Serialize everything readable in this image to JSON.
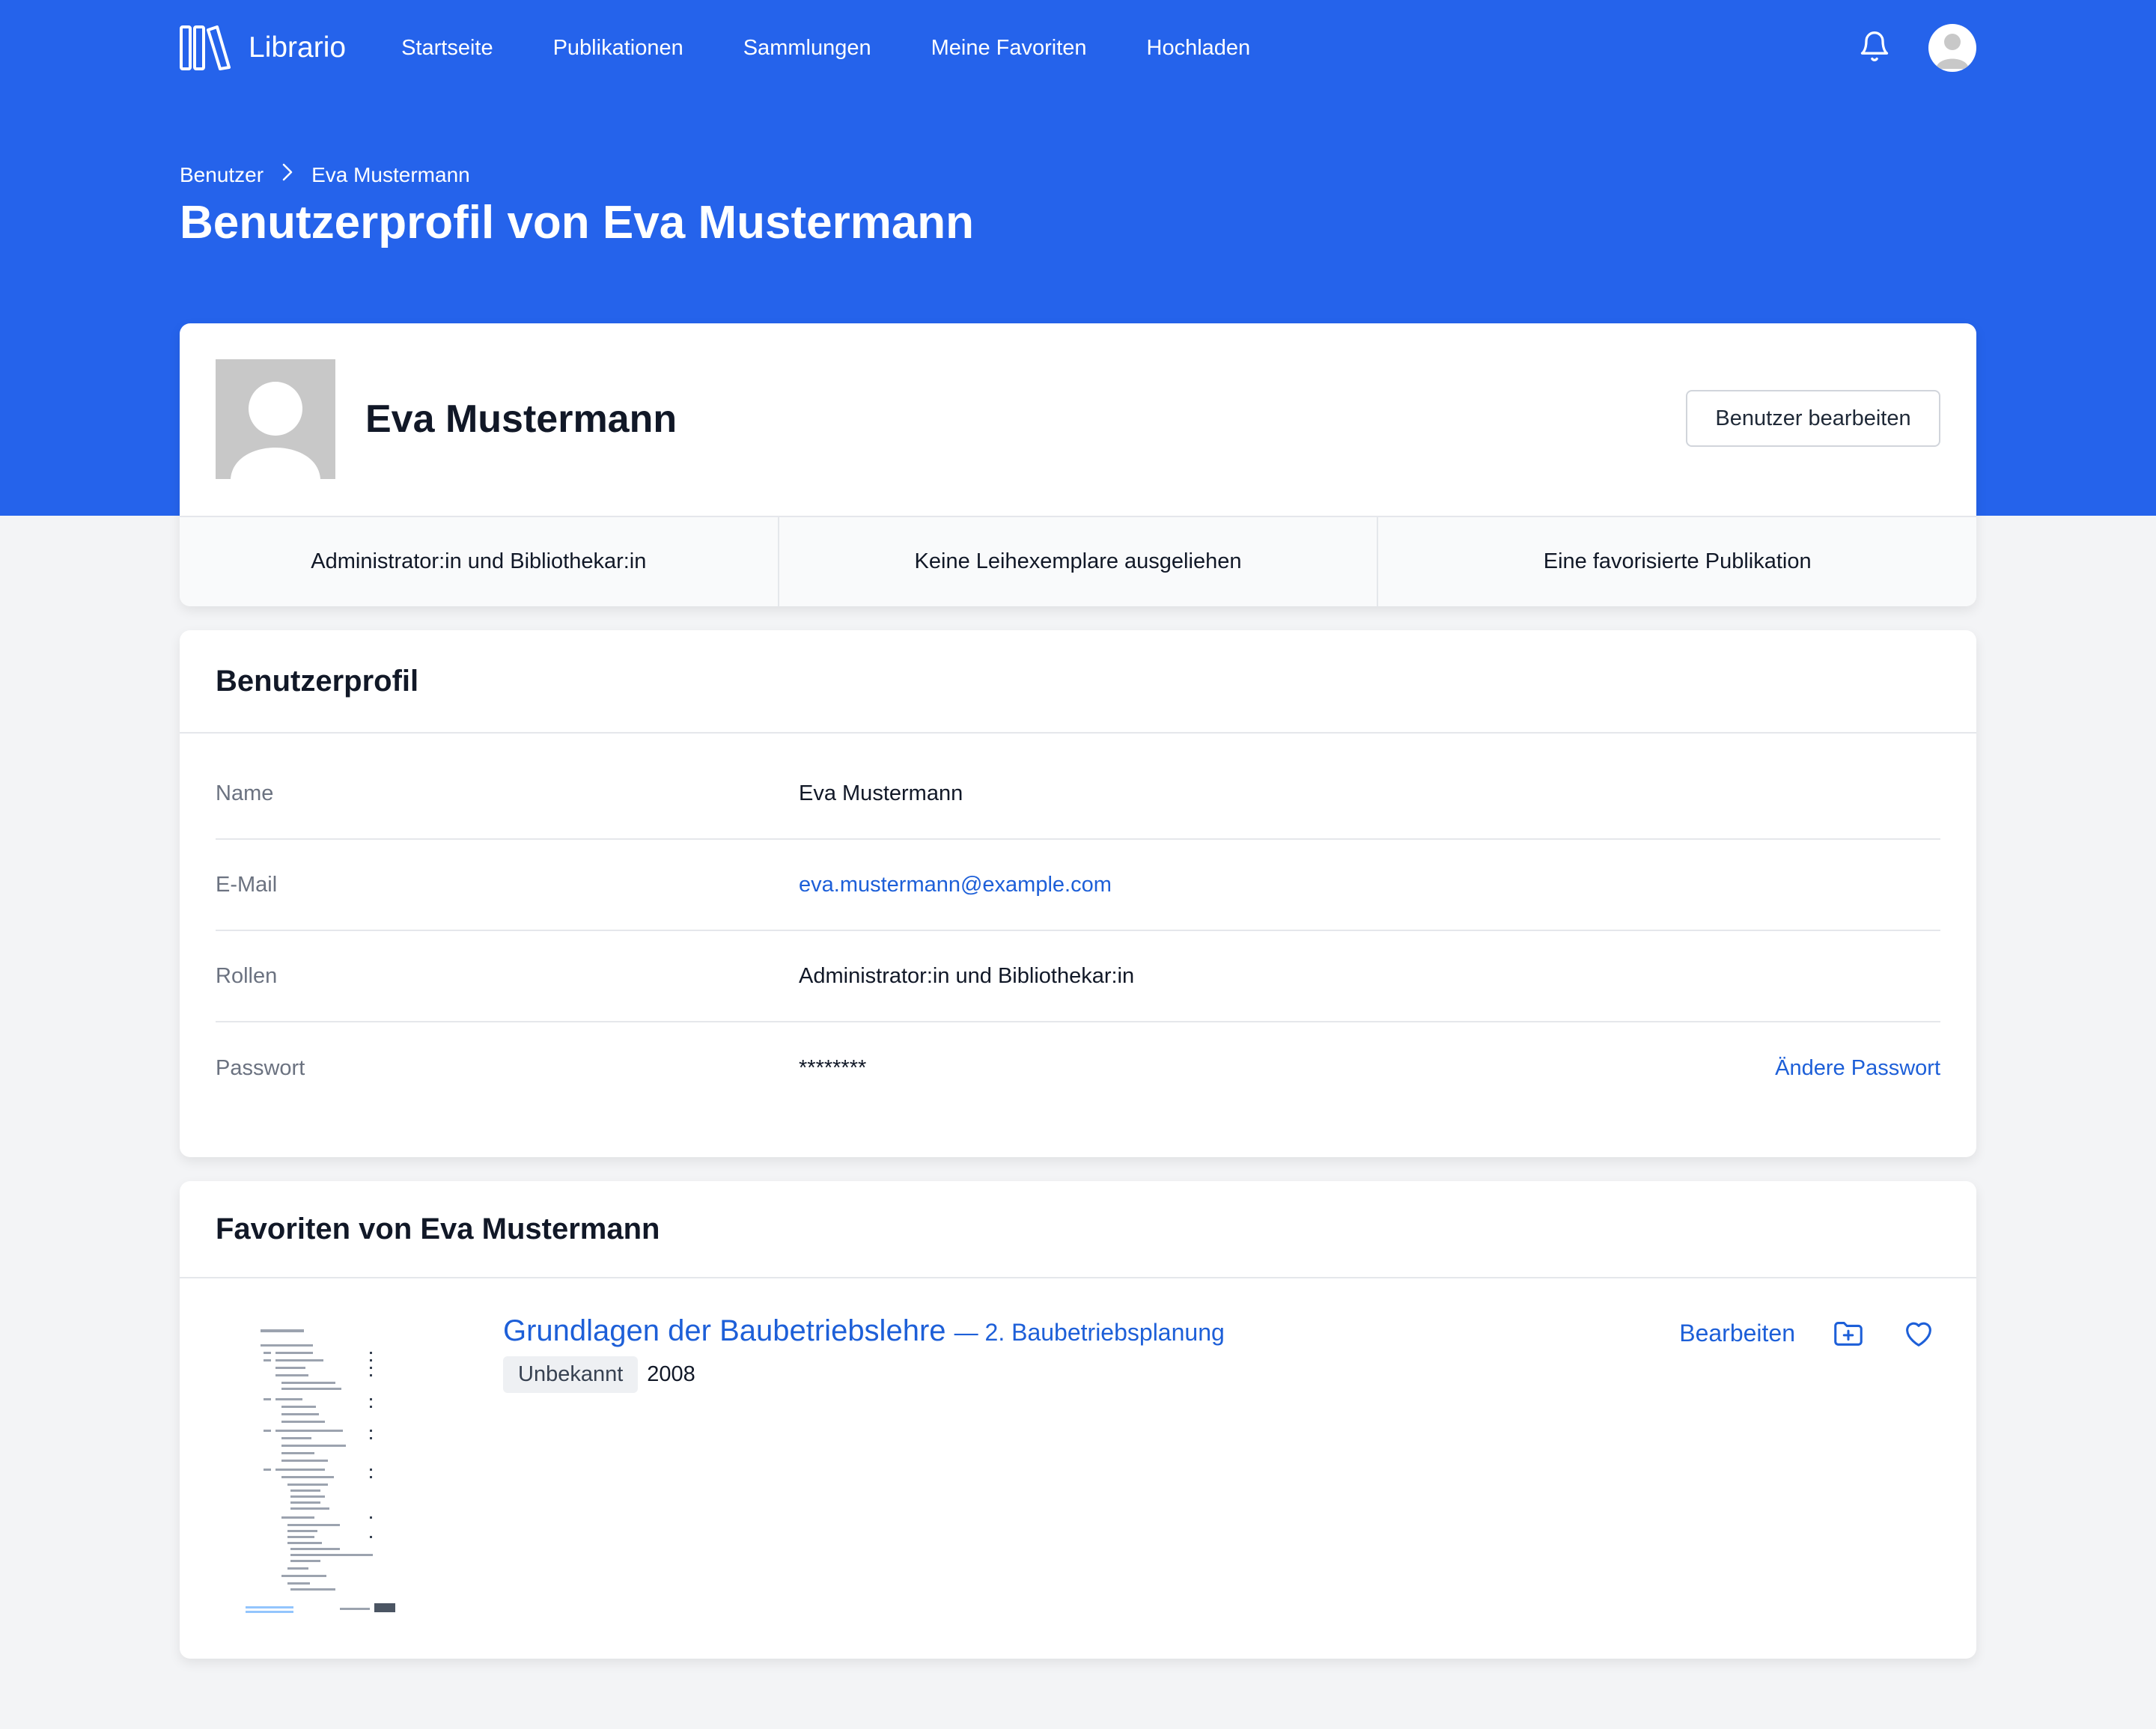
{
  "app": {
    "name": "Librario"
  },
  "nav": {
    "items": [
      {
        "label": "Startseite"
      },
      {
        "label": "Publikationen"
      },
      {
        "label": "Sammlungen"
      },
      {
        "label": "Meine Favoriten"
      },
      {
        "label": "Hochladen"
      }
    ]
  },
  "breadcrumb": {
    "parent": "Benutzer",
    "current": "Eva Mustermann"
  },
  "page": {
    "title": "Benutzerprofil von Eva Mustermann"
  },
  "profile": {
    "name": "Eva Mustermann",
    "edit_button": "Benutzer bearbeiten",
    "stats": [
      {
        "text": "Administrator:in und Bibliothekar:in"
      },
      {
        "text": "Keine Leihexemplare ausgeliehen"
      },
      {
        "text": "Eine favorisierte Publikation"
      }
    ]
  },
  "details": {
    "title": "Benutzerprofil",
    "rows": [
      {
        "label": "Name",
        "value": "Eva Mustermann"
      },
      {
        "label": "E-Mail",
        "value": "eva.mustermann@example.com"
      },
      {
        "label": "Rollen",
        "value": "Administrator:in und Bibliothekar:in"
      },
      {
        "label": "Passwort",
        "value": "********",
        "action": "Ändere Passwort"
      }
    ]
  },
  "favorites": {
    "title": "Favoriten von Eva Mustermann",
    "items": [
      {
        "title": "Grundlagen der Baubetriebslehre",
        "subtitle": "— 2. Baubetriebsplanung",
        "badge": "Unbekannt",
        "year": "2008",
        "edit": "Bearbeiten"
      }
    ]
  },
  "colors": {
    "brand": "#2563eb",
    "link": "#1d5fd8",
    "background": "#f3f4f6"
  },
  "icons": [
    "librario-logo",
    "bell-icon",
    "user-avatar",
    "chevron-right-icon",
    "folder-plus-icon",
    "heart-icon"
  ]
}
